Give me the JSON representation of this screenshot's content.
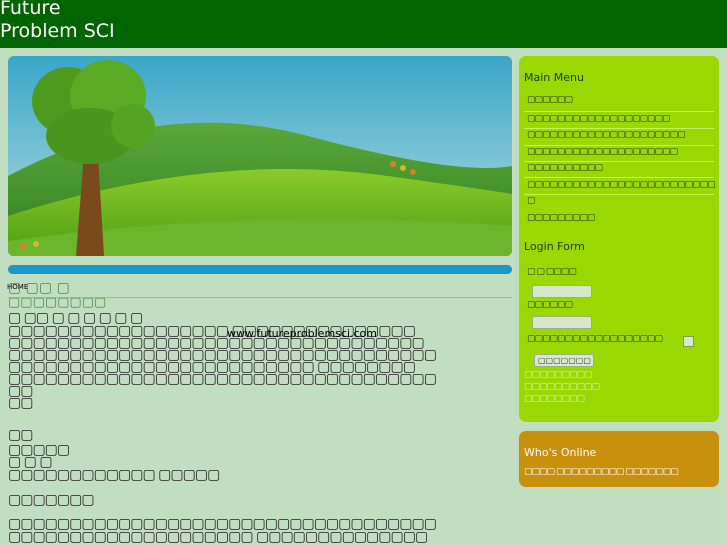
{
  "header": {
    "title_line1": "Future",
    "title_line2": "Problem SCI"
  },
  "breadcrumb": "HOME",
  "watermark_url": "www.futureproblemsci.com",
  "main": {
    "glyph_row_top": "▢ ▢▢ ▢",
    "glyph_row_sub": "▢▢▢▢▢▢▢▢",
    "paragraph1": [
      "▢ ▢▢ ▢ ▢ ▢ ▢ ▢ ▢",
      "▢▢▢▢▢▢▢▢▢▢▢▢▢▢▢▢▢▢ ▢▢▢▢▢▢▢▢▢▢▢▢▢▢▢",
      "▢▢▢▢▢▢▢▢▢▢▢▢▢▢▢▢▢▢▢▢▢▢▢▢▢▢▢▢▢▢▢▢▢▢",
      "▢▢▢▢▢▢▢▢▢▢▢▢▢▢▢▢▢▢▢▢▢▢▢▢▢▢▢▢▢▢▢▢▢▢▢",
      "▢▢▢▢▢▢▢▢▢▢▢▢▢▢▢▢▢▢▢▢▢▢▢▢▢ ▢▢▢▢▢▢▢▢",
      "▢▢▢▢▢▢▢▢▢▢▢▢▢▢▢▢▢▢▢▢▢▢▢▢▢▢▢▢▢▢▢▢▢▢▢",
      "▢▢"
    ],
    "paragraph2": [
      "▢▢",
      "▢▢▢▢▢",
      "▢ ▢ ▢",
      "▢▢▢▢▢▢▢▢▢▢▢▢ ▢▢▢▢▢",
      "▢▢▢▢▢▢▢",
      "▢▢▢▢▢▢▢▢▢▢▢▢▢▢▢▢▢▢▢▢▢▢▢▢▢▢▢▢▢▢▢▢▢▢▢",
      "▢▢▢▢▢▢▢▢▢▢▢▢▢▢▢▢▢▢▢▢ ▢▢▢▢▢▢▢▢▢▢▢▢▢▢"
    ]
  },
  "main_menu": {
    "title": "Main Menu",
    "items": [
      "▢▢▢▢▢▢",
      "▢▢▢▢▢▢▢▢▢▢▢▢▢▢▢▢▢▢▢",
      "▢▢▢▢▢▢▢▢▢▢▢▢▢▢▢▢▢▢▢▢▢",
      "▢▢▢▢▢▢▢▢▢▢▢▢▢▢▢▢▢▢▢▢",
      "▢▢▢▢▢▢▢▢▢▢",
      "▢▢▢▢▢▢▢▢▢▢▢▢▢▢▢▢▢▢▢▢▢▢▢▢▢",
      "▢",
      "▢▢▢▢▢▢▢▢▢"
    ]
  },
  "login_form": {
    "title": "Login Form",
    "username_label": "▢ ▢ ▢▢▢▢",
    "password_label": "▢▢▢▢▢▢",
    "remember_label": "▢▢▢▢▢▢▢▢▢▢▢▢▢▢▢▢▢▢",
    "login_button": "▢▢▢▢▢▢▢",
    "links": [
      "▢▢▢▢▢▢▢▢▢",
      "▢▢▢▢▢▢▢▢▢▢",
      "▢▢▢▢▢▢▢▢"
    ]
  },
  "whos_online": {
    "title": "Who's Online",
    "text": "▢▢▢▢ ▢▢▢▢▢▢▢▢▢ ▢▢▢▢▢▢▢"
  },
  "colors": {
    "header_bg": "#006400",
    "page_bg": "#c2dec0",
    "sidebar_bg": "#99d800",
    "online_bg": "#c8900c",
    "bar_blue": "#1a98c8"
  }
}
